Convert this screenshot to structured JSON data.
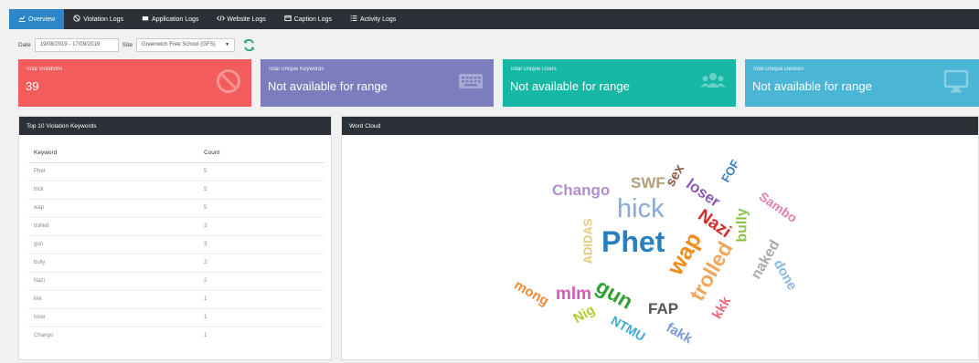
{
  "nav": {
    "tabs": [
      {
        "label": "Overview",
        "icon": "chart-icon"
      },
      {
        "label": "Violation Logs",
        "icon": "ban-icon"
      },
      {
        "label": "Application Logs",
        "icon": "hdd-icon"
      },
      {
        "label": "Website Logs",
        "icon": "code-icon"
      },
      {
        "label": "Caption Logs",
        "icon": "window-icon"
      },
      {
        "label": "Activity Logs",
        "icon": "list-icon"
      }
    ]
  },
  "filters": {
    "date_label": "Date",
    "date_value": "19/08/2019 - 17/09/2019",
    "site_label": "Site",
    "site_value": "Greenwich Free School (GFS)"
  },
  "cards": [
    {
      "label": "Total Violations",
      "value": "39",
      "color": "#f25c5c",
      "icon": "ban-icon"
    },
    {
      "label": "Total Unique Keywords",
      "value": "Not available for range",
      "color": "#7b7dbd",
      "icon": "keyboard-icon"
    },
    {
      "label": "Total Unique Users",
      "value": "Not available for range",
      "color": "#17b7a5",
      "icon": "users-icon"
    },
    {
      "label": "Total Unique Devices",
      "value": "Not available for range",
      "color": "#4bb5d6",
      "icon": "monitor-icon"
    }
  ],
  "keywords_panel": {
    "title": "Top 10 Violation Keywords",
    "columns": [
      "Keyword",
      "Count"
    ],
    "rows": [
      {
        "keyword": "Phet",
        "count": "5"
      },
      {
        "keyword": "hick",
        "count": "5"
      },
      {
        "keyword": "wap",
        "count": "5"
      },
      {
        "keyword": "trolled",
        "count": "3"
      },
      {
        "keyword": "gun",
        "count": "3"
      },
      {
        "keyword": "bully",
        "count": "2"
      },
      {
        "keyword": "Nazi",
        "count": "2"
      },
      {
        "keyword": "kkk",
        "count": "1"
      },
      {
        "keyword": "loser",
        "count": "1"
      },
      {
        "keyword": "Chango",
        "count": "1"
      }
    ]
  },
  "cloud_panel": {
    "title": "Word Cloud",
    "words": [
      {
        "text": "Chango",
        "color": "#b38ccc"
      },
      {
        "text": "SWF",
        "color": "#b3a07a"
      },
      {
        "text": "sex",
        "color": "#8c5a4a"
      },
      {
        "text": "loser",
        "color": "#8c5ab3"
      },
      {
        "text": "FOF",
        "color": "#3a7fc0"
      },
      {
        "text": "Sambo",
        "color": "#e87fb3"
      },
      {
        "text": "hick",
        "color": "#88aad4"
      },
      {
        "text": "Nazi",
        "color": "#d62a2a"
      },
      {
        "text": "bully",
        "color": "#8cc44a"
      },
      {
        "text": "ADIDAS",
        "color": "#e8c97a"
      },
      {
        "text": "Phet",
        "color": "#2a7fbf"
      },
      {
        "text": "wap",
        "color": "#f28c1a"
      },
      {
        "text": "trolled",
        "color": "#f2a65a"
      },
      {
        "text": "naked",
        "color": "#aaaaaa"
      },
      {
        "text": "done",
        "color": "#88b8e0"
      },
      {
        "text": "mong",
        "color": "#f28c3a"
      },
      {
        "text": "mlm",
        "color": "#d45ab3"
      },
      {
        "text": "gun",
        "color": "#33a033"
      },
      {
        "text": "Nig",
        "color": "#b3cc33"
      },
      {
        "text": "FAP",
        "color": "#555555"
      },
      {
        "text": "kkk",
        "color": "#e86a7a"
      },
      {
        "text": "NTMU",
        "color": "#3aaad4"
      },
      {
        "text": "fakk",
        "color": "#7a9ad4"
      }
    ]
  }
}
